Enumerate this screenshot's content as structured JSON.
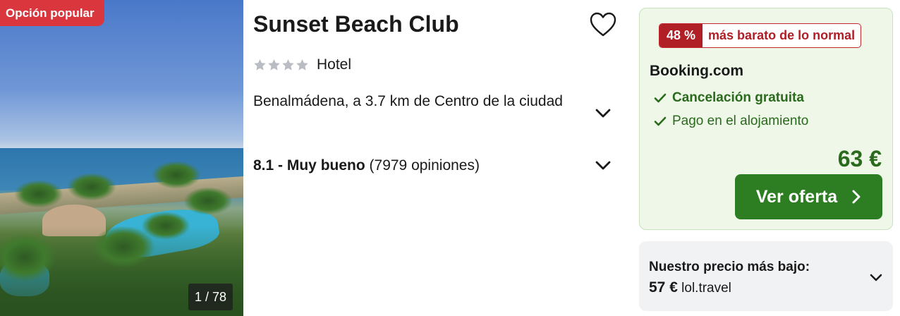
{
  "listing": {
    "badge": "Opción popular",
    "image_counter": "1 / 78",
    "title": "Sunset Beach Club",
    "stars": 4,
    "type": "Hotel",
    "location": "Benalmádena, a 3.7 km de Centro de la ciudad",
    "rating_score": "8.1 - Muy bueno",
    "rating_count": "(7979 opiniones)"
  },
  "offer": {
    "discount_pct": "48 %",
    "discount_text": "más barato de lo normal",
    "provider": "Booking.com",
    "features": [
      "Cancelación gratuita",
      "Pago en el alojamiento"
    ],
    "price": "63 €",
    "cta_label": "Ver oferta"
  },
  "lowest_price": {
    "label": "Nuestro precio más bajo:",
    "price": "57 €",
    "provider": "lol.travel"
  },
  "icons": {
    "favorite": "heart-outline-icon",
    "expand": "chevron-down-icon",
    "check": "check-icon",
    "cta_arrow": "chevron-right-icon"
  },
  "colors": {
    "popular_badge": "#d9363e",
    "deal_red": "#b01e26",
    "offer_green": "#2a6a1c",
    "cta_green": "#2d7d22",
    "offer_bg": "#eef7e8"
  }
}
